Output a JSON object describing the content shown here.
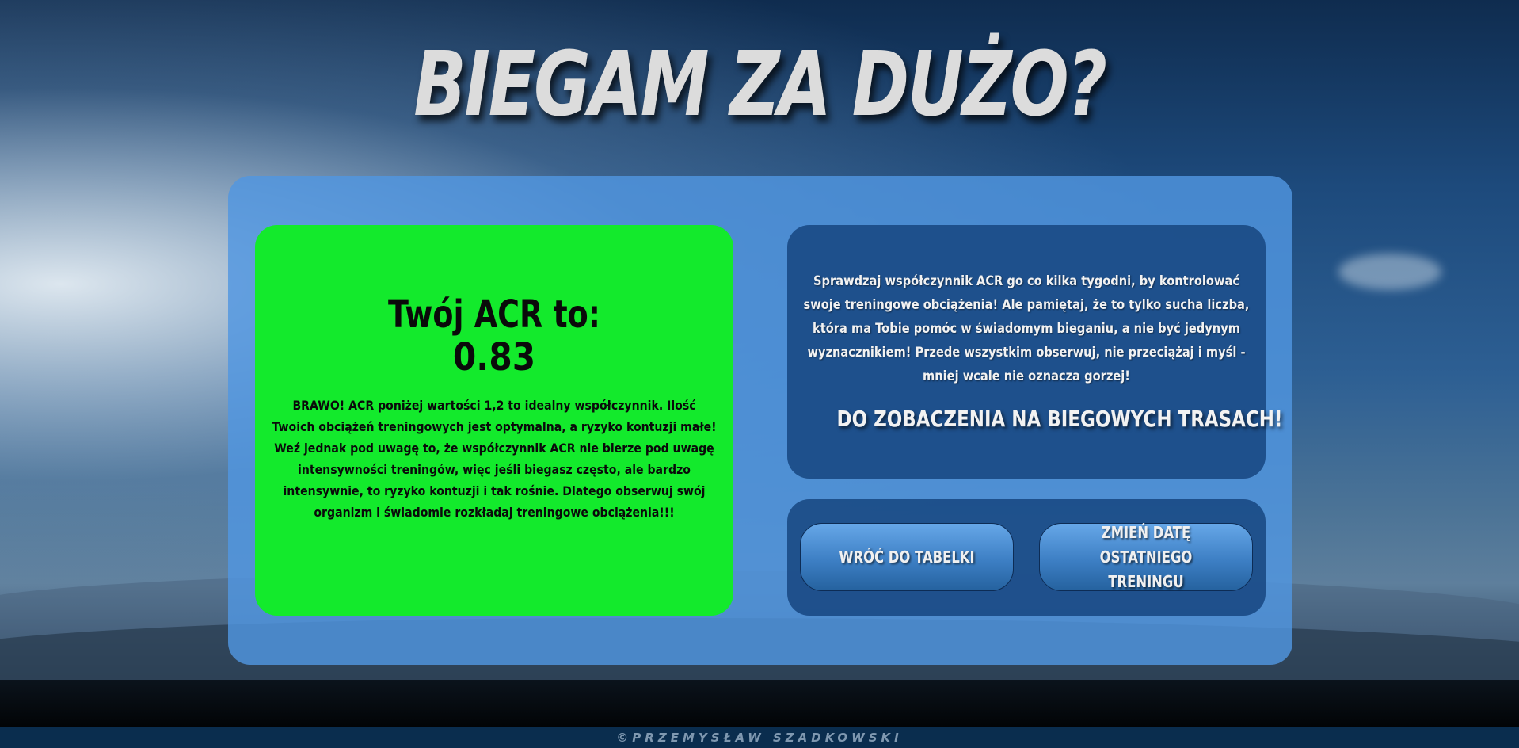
{
  "header": {
    "title": "BIEGAM ZA DUŻO?"
  },
  "result": {
    "heading": "Twój ACR to:",
    "value": "0.83",
    "description": "BRAWO! ACR poniżej wartości 1,2 to idealny współczynnik. Ilość Twoich obciążeń treningowych jest optymalna, a ryzyko kontuzji małe! Weź jednak pod uwagę to, że współczynnik ACR nie bierze pod uwagę intensywności treningów, więc jeśli biegasz często, ale bardzo intensywnie, to ryzyko kontuzji i tak rośnie. Dlatego obserwuj swój organizm i świadomie rozkładaj treningowe obciążenia!!!",
    "status_color": "#13ea2c"
  },
  "info": {
    "text": "Sprawdzaj współczynnik ACR go co kilka tygodni, by kontrolować swoje treningowe obciążenia! Ale pamiętaj, że to tylko sucha liczba, która ma Tobie pomóc w świadomym bieganiu, a nie być jedynym wyznacznikiem! Przede wszystkim obserwuj, nie przeciążaj i myśl - mniej wcale nie oznacza gorzej!",
    "farewell": "DO ZOBACZENIA NA BIEGOWYCH TRASACH!"
  },
  "buttons": {
    "back_label": "WRÓĆ DO TABELKI",
    "change_date_label": "ZMIEŃ DATĘ OSTATNIEGO TRENINGU"
  },
  "footer": {
    "copyright": "©PRZEMYSŁAW SZADKOWSKI"
  }
}
